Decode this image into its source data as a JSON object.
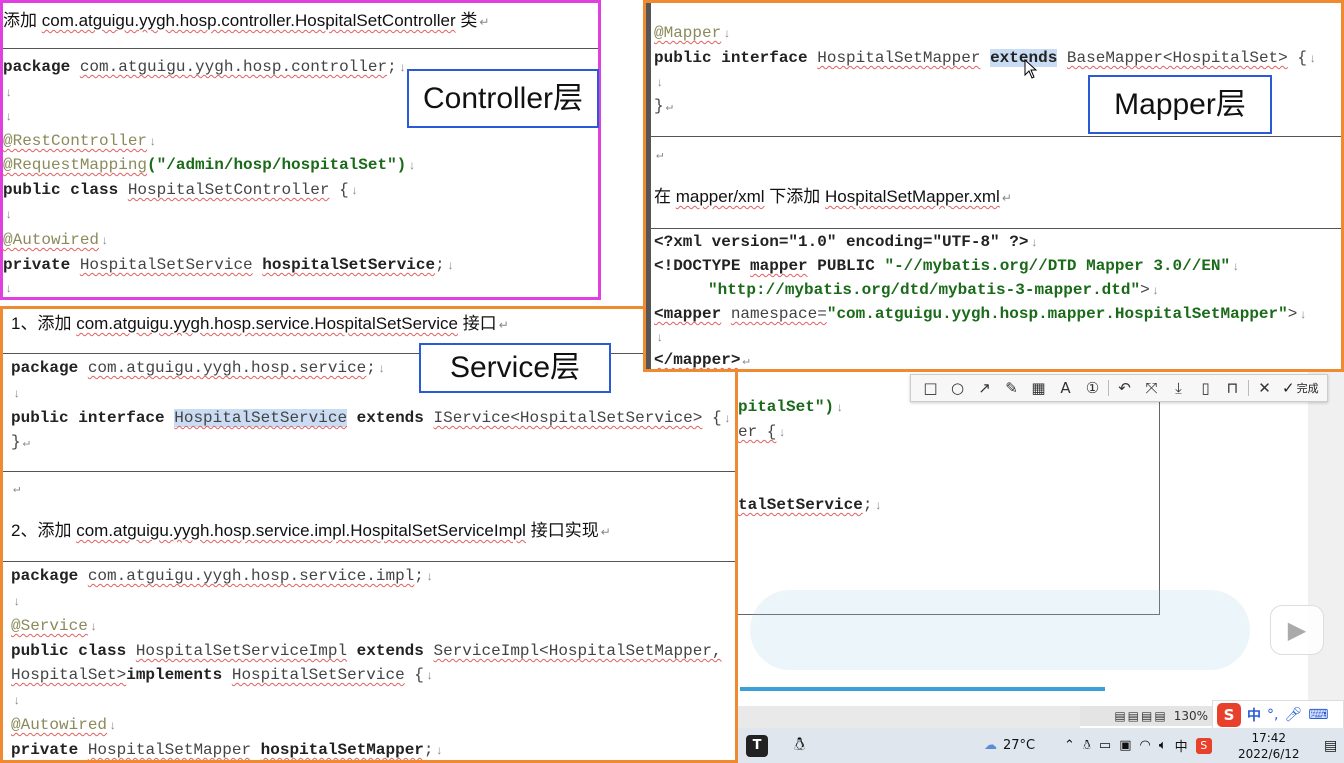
{
  "controller": {
    "heading_prefix": "添加",
    "heading_path": "com.atguigu.yygh.hosp.controller.HospitalSetController",
    "heading_suffix": "类",
    "label": "Controller层",
    "package_kw": "package",
    "package_name": "com.atguigu.yygh.hosp.controller",
    "semicolon": ";",
    "ann_rest": "@RestController",
    "ann_mapping": "@RequestMapping",
    "mapping_value": "(\"/admin/hosp/hospitalSet\")",
    "class_kw": "public class",
    "class_name": "HospitalSetController",
    "brace": "{",
    "ann_autowired": "@Autowired",
    "field_kw": "private",
    "field_type": "HospitalSetService",
    "field_name": "hospitalSetService",
    "field_end": ";"
  },
  "service": {
    "label": "Service层",
    "step1_prefix": "1、添加",
    "step1_path": "com.atguigu.yygh.hosp.service.HospitalSetService",
    "step1_suffix": "接口",
    "package_kw": "package",
    "package_name": "com.atguigu.yygh.hosp.service",
    "interface_kw": "public interface",
    "interface_name": "HospitalSetService",
    "extends_kw": "extends",
    "extends_type": "IService<HospitalSetService>",
    "brace_open": "{",
    "brace_close": "}",
    "step2_prefix": "2、添加",
    "step2_path": "com.atguigu.yygh.hosp.service.impl.HospitalSetServiceImpl",
    "step2_suffix": "接口实现",
    "impl_package_name": "com.atguigu.yygh.hosp.service.impl",
    "ann_service": "@Service",
    "class_kw": "public class",
    "impl_class_name": "HospitalSetServiceImpl",
    "impl_extends": "ServiceImpl<HospitalSetMapper,",
    "impl_generic_tail": "HospitalSet>",
    "implements_kw": "implements",
    "implements_type": "HospitalSetService",
    "ann_autowired": "@Autowired",
    "field_kw": "private",
    "field_type": "HospitalSetMapper",
    "field_name": "hospitalSetMapper",
    "field_end": ";"
  },
  "mapper": {
    "label": "Mapper层",
    "ann_mapper": "@Mapper",
    "interface_kw": "public interface",
    "interface_name": "HospitalSetMapper",
    "extends_kw": "extends",
    "extends_type": "BaseMapper<HospitalSet>",
    "brace_open": "{",
    "brace_close": "}",
    "xml_prefix": "在",
    "xml_dir": "mapper/xml",
    "xml_mid": "下添加",
    "xml_file": "HospitalSetMapper.xml",
    "xml_decl": "<?xml version=\"1.0\" encoding=\"UTF-8\" ?>",
    "doctype_kw": "<!DOCTYPE",
    "doctype_mapper": "mapper",
    "doctype_public": "PUBLIC",
    "doctype_id": "\"-//mybatis.org//DTD Mapper 3.0//EN\"",
    "doctype_dtd": "\"http://mybatis.org/dtd/mybatis-3-mapper.dtd\"",
    "doctype_end": ">",
    "mapper_open": "<mapper",
    "namespace_attr": "namespace=",
    "namespace_value": "\"com.atguigu.yygh.hosp.mapper.HospitalSetMapper\"",
    "mapper_open_end": ">",
    "mapper_close": "</mapper>"
  },
  "backdrop": {
    "frag1": "pitalSet\")",
    "frag2": "er {",
    "frag3": "talSetService",
    "frag3_end": ";"
  },
  "toolbar": {
    "done_label": "完成"
  },
  "statusbar": {
    "zoom": "130%"
  },
  "ime": {
    "lang": "中",
    "punct": "°,"
  },
  "taskbar": {
    "app_t": "T",
    "temperature": "27°C",
    "lang": "中",
    "time": "17:42",
    "date": "2022/6/12"
  }
}
